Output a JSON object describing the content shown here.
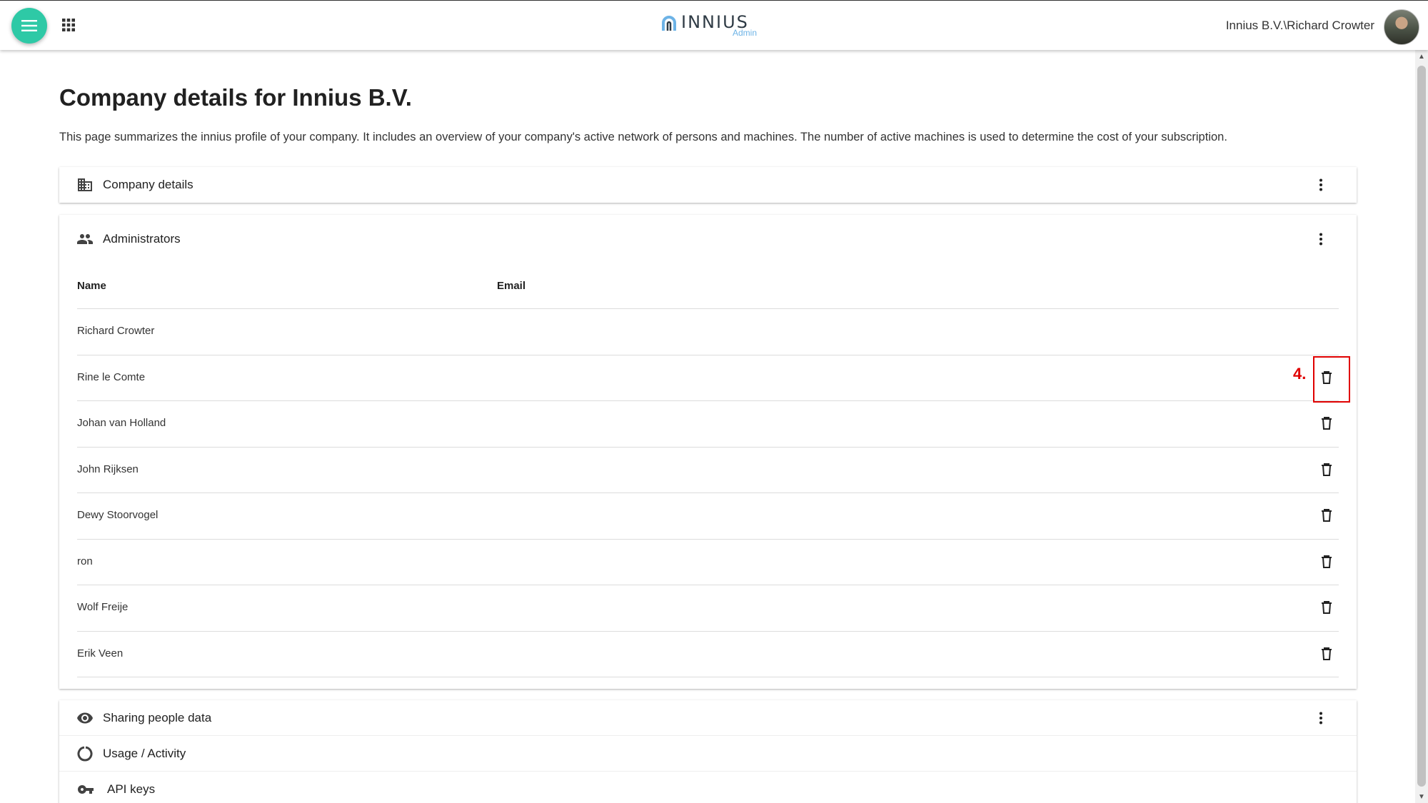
{
  "header": {
    "logo_text": "INNIUS",
    "logo_sub": "Admin",
    "user": "Innius B.V.\\Richard Crowter",
    "accent_color": "#2ec9a6"
  },
  "page": {
    "title": "Company details for Innius B.V.",
    "description": "This page summarizes the innius profile of your company. It includes an overview of your company's active network of persons and machines. The number of active machines is used to determine the cost of your subscription."
  },
  "company_card": {
    "title": "Company details",
    "icon": "building-icon"
  },
  "admins_card": {
    "title": "Administrators",
    "icon": "people-icon",
    "columns": [
      "Name",
      "Email"
    ],
    "rows": [
      {
        "name": "Richard Crowter",
        "email": "",
        "deletable": false
      },
      {
        "name": "Rine le Comte",
        "email": "",
        "deletable": true
      },
      {
        "name": "Johan van Holland",
        "email": "",
        "deletable": true
      },
      {
        "name": "John Rijksen",
        "email": "",
        "deletable": true
      },
      {
        "name": "Dewy Stoorvogel",
        "email": "",
        "deletable": true
      },
      {
        "name": "ron",
        "email": "",
        "deletable": true
      },
      {
        "name": "Wolf Freije",
        "email": "",
        "deletable": true
      },
      {
        "name": "Erik Veen",
        "email": "",
        "deletable": true
      }
    ]
  },
  "annotation": {
    "label": "4.",
    "color": "#e00000"
  },
  "bottom_card": {
    "sections": [
      {
        "title": "Sharing people data",
        "icon": "eye-icon"
      },
      {
        "title": "Usage / Activity",
        "icon": "donut-icon"
      },
      {
        "title": "API keys",
        "icon": "key-icon"
      }
    ]
  }
}
